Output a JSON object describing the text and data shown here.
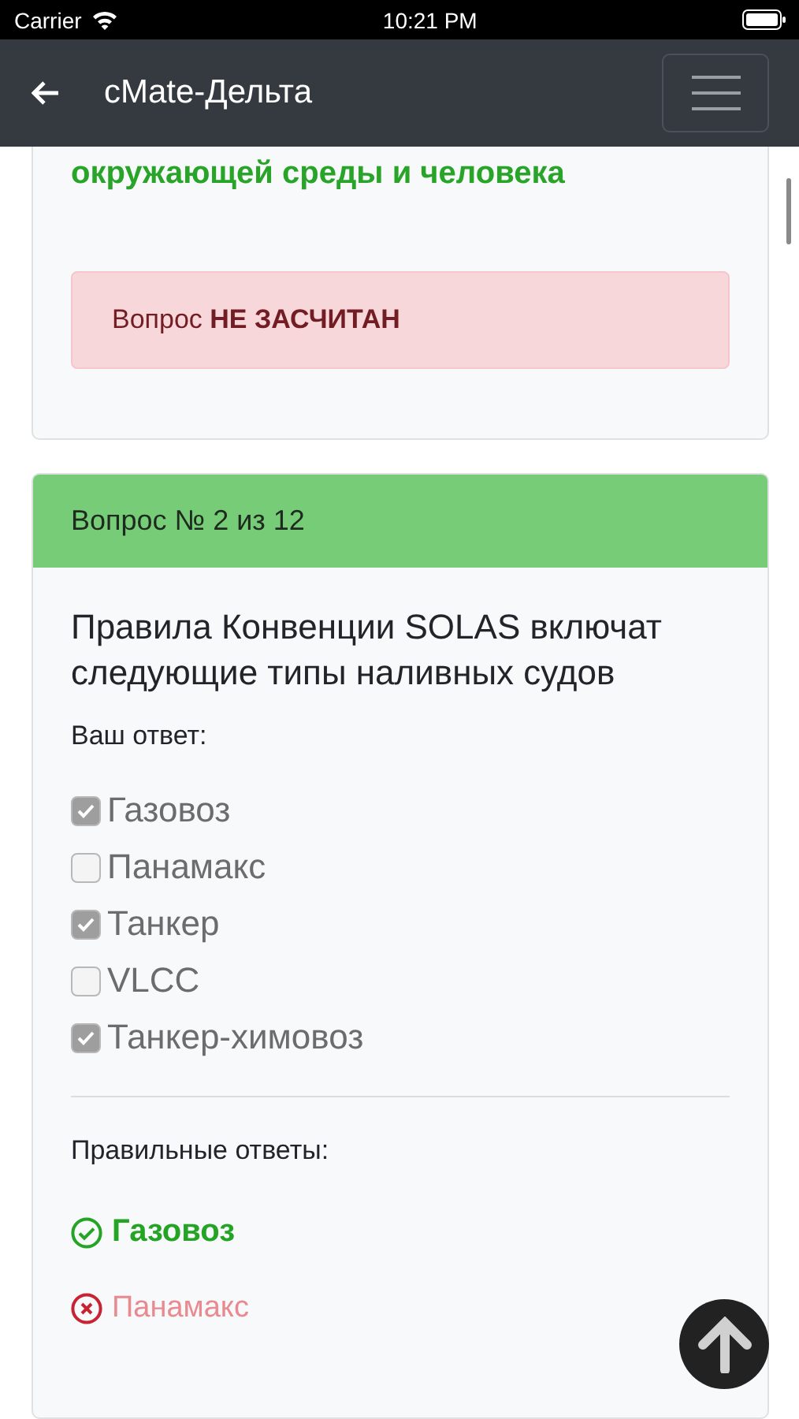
{
  "status_bar": {
    "carrier": "Carrier",
    "time": "10:21 PM"
  },
  "navbar": {
    "title": "cMate-Дельта"
  },
  "previous_question": {
    "answer_tail": "окружающей среды и человека",
    "verdict": "Вопрос **НЕ ЗАСЧИТАН**"
  },
  "question": {
    "header": "Вопрос № 2 из 12",
    "text": "Правила Конвенции SOLAS включат следующие типы наливных судов",
    "your_answer_label": "Ваш ответ:",
    "options": [
      {
        "label": "Газовоз",
        "checked": true
      },
      {
        "label": "Панамакс",
        "checked": false
      },
      {
        "label": "Танкер",
        "checked": true
      },
      {
        "label": "VLCC",
        "checked": false
      },
      {
        "label": "Танкер-химовоз",
        "checked": true
      }
    ],
    "correct_label": "Правильные ответы:",
    "results": [
      {
        "label": "Газовоз",
        "correct": true
      },
      {
        "label": "Панамакс",
        "correct": false
      }
    ]
  }
}
